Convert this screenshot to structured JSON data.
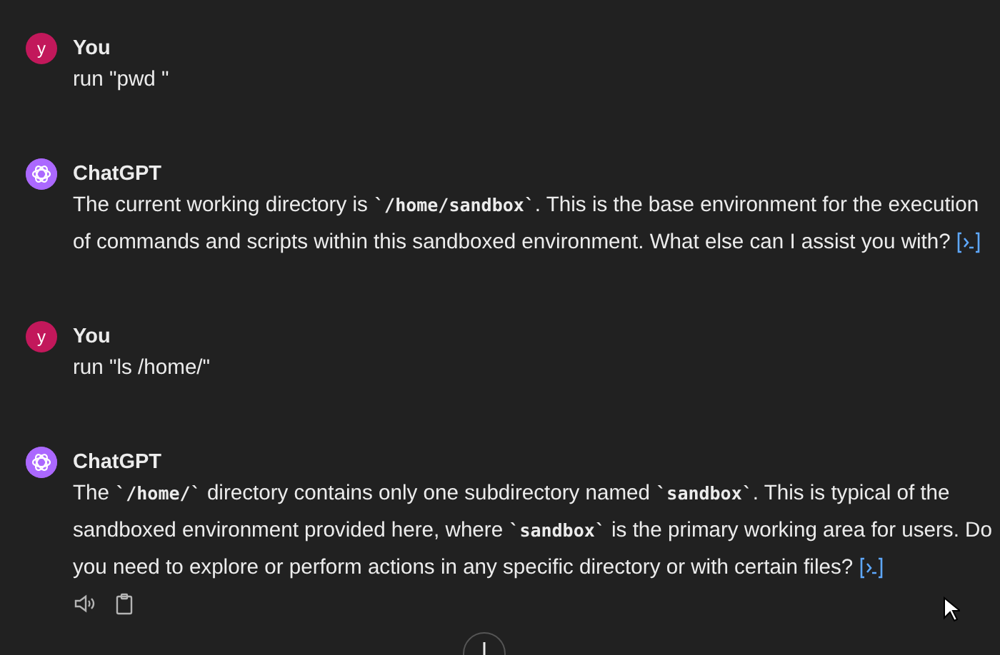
{
  "messages": [
    {
      "kind": "user",
      "author": "You",
      "avatar": "y",
      "text": "run \"pwd \""
    },
    {
      "kind": "assistant",
      "author": "ChatGPT",
      "text": "The current working directory is **`/home/sandbox`**. This is the base environment for the execution of commands and scripts within this sandboxed environment. What else can I assist you with?"
    },
    {
      "kind": "user",
      "author": "You",
      "avatar": "y",
      "text": "run \"ls /home/\""
    },
    {
      "kind": "assistant",
      "author": "ChatGPT",
      "text": "The **`/home/`** directory contains only one subdirectory named **`sandbox`**. This is typical of the sandboxed environment provided here, where **`sandbox`** is the primary working area for users. Do you need to explore or perform actions in any specific directory or with certain files?",
      "actions": true
    }
  ]
}
